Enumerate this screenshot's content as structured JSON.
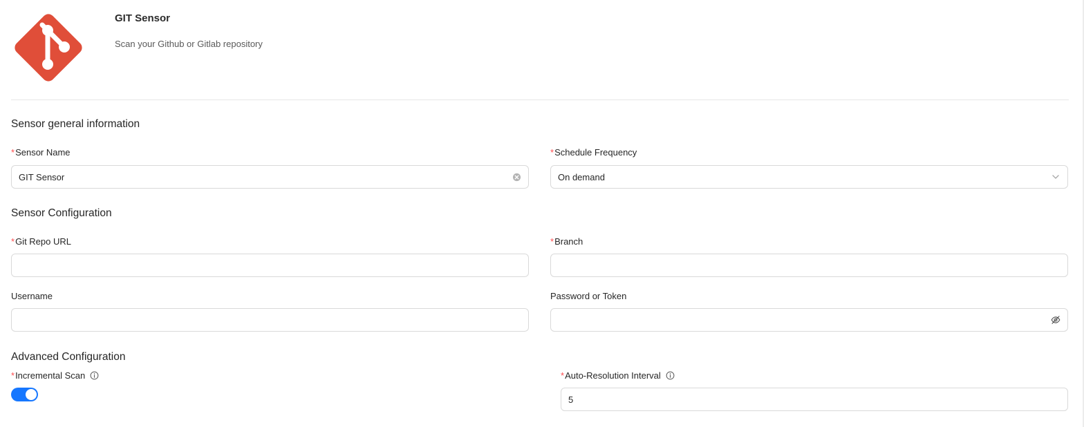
{
  "header": {
    "title": "GIT Sensor",
    "subtitle": "Scan your Github or Gitlab repository",
    "logo_icon": "git-logo-icon",
    "logo_color": "#e04e39"
  },
  "sections": {
    "general": "Sensor general information",
    "configuration": "Sensor Configuration",
    "advanced": "Advanced Configuration"
  },
  "required_marker": "*",
  "fields": {
    "sensor_name": {
      "label": "Sensor Name",
      "value": "GIT Sensor",
      "suffix_icon": "clear-icon"
    },
    "schedule_frequency": {
      "label": "Schedule Frequency",
      "value": "On demand",
      "suffix_icon": "chevron-down-icon"
    },
    "git_repo_url": {
      "label": "Git Repo URL",
      "value": ""
    },
    "branch": {
      "label": "Branch",
      "value": ""
    },
    "username": {
      "label": "Username",
      "value": ""
    },
    "password": {
      "label": "Password or Token",
      "value": "",
      "suffix_icon": "eye-invisible-icon"
    },
    "incremental_scan": {
      "label": "Incremental Scan",
      "enabled": true,
      "info_icon": "info-icon"
    },
    "auto_resolution_interval": {
      "label": "Auto-Resolution Interval",
      "value": "5",
      "info_icon": "info-icon"
    }
  },
  "colors": {
    "accent": "#1677ff",
    "required": "#ff4d4f",
    "border": "#d9d9d9"
  }
}
